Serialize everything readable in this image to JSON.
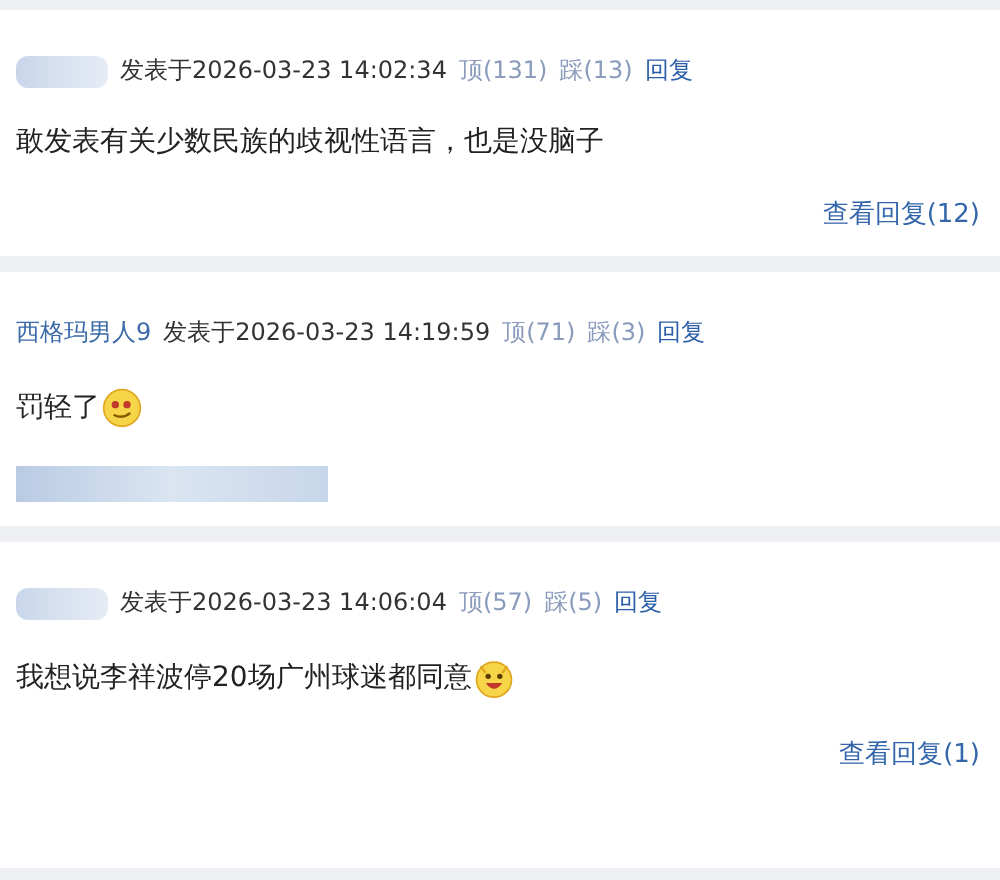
{
  "comments": [
    {
      "author": {
        "kind": "redacted"
      },
      "posted": "发表于2026-03-23 14:02:34",
      "up": "顶(131)",
      "down": "踩(13)",
      "reply": "回复",
      "body": [
        [
          {
            "kind": "text",
            "text": "敢发表有关少数民族的歧视性语言，也是没脑子"
          }
        ]
      ],
      "view_replies": "查看回复(12)"
    },
    {
      "author": {
        "kind": "name",
        "text": "西格玛男人9"
      },
      "posted": "发表于2026-03-23 14:19:59",
      "up": "顶(71)",
      "down": "踩(3)",
      "reply": "回复",
      "body": [
        [
          {
            "kind": "text",
            "text": "罚轻了"
          },
          {
            "kind": "smiley"
          }
        ],
        [
          {
            "kind": "redacted"
          }
        ]
      ]
    },
    {
      "author": {
        "kind": "redacted"
      },
      "posted": "发表于2026-03-23 14:06:04",
      "up": "顶(57)",
      "down": "踩(5)",
      "reply": "回复",
      "body": [
        [
          {
            "kind": "text",
            "text": "我想说李祥波停20场广州球迷都同意"
          },
          {
            "kind": "grin"
          }
        ]
      ],
      "view_replies": "查看回复(1)"
    }
  ]
}
